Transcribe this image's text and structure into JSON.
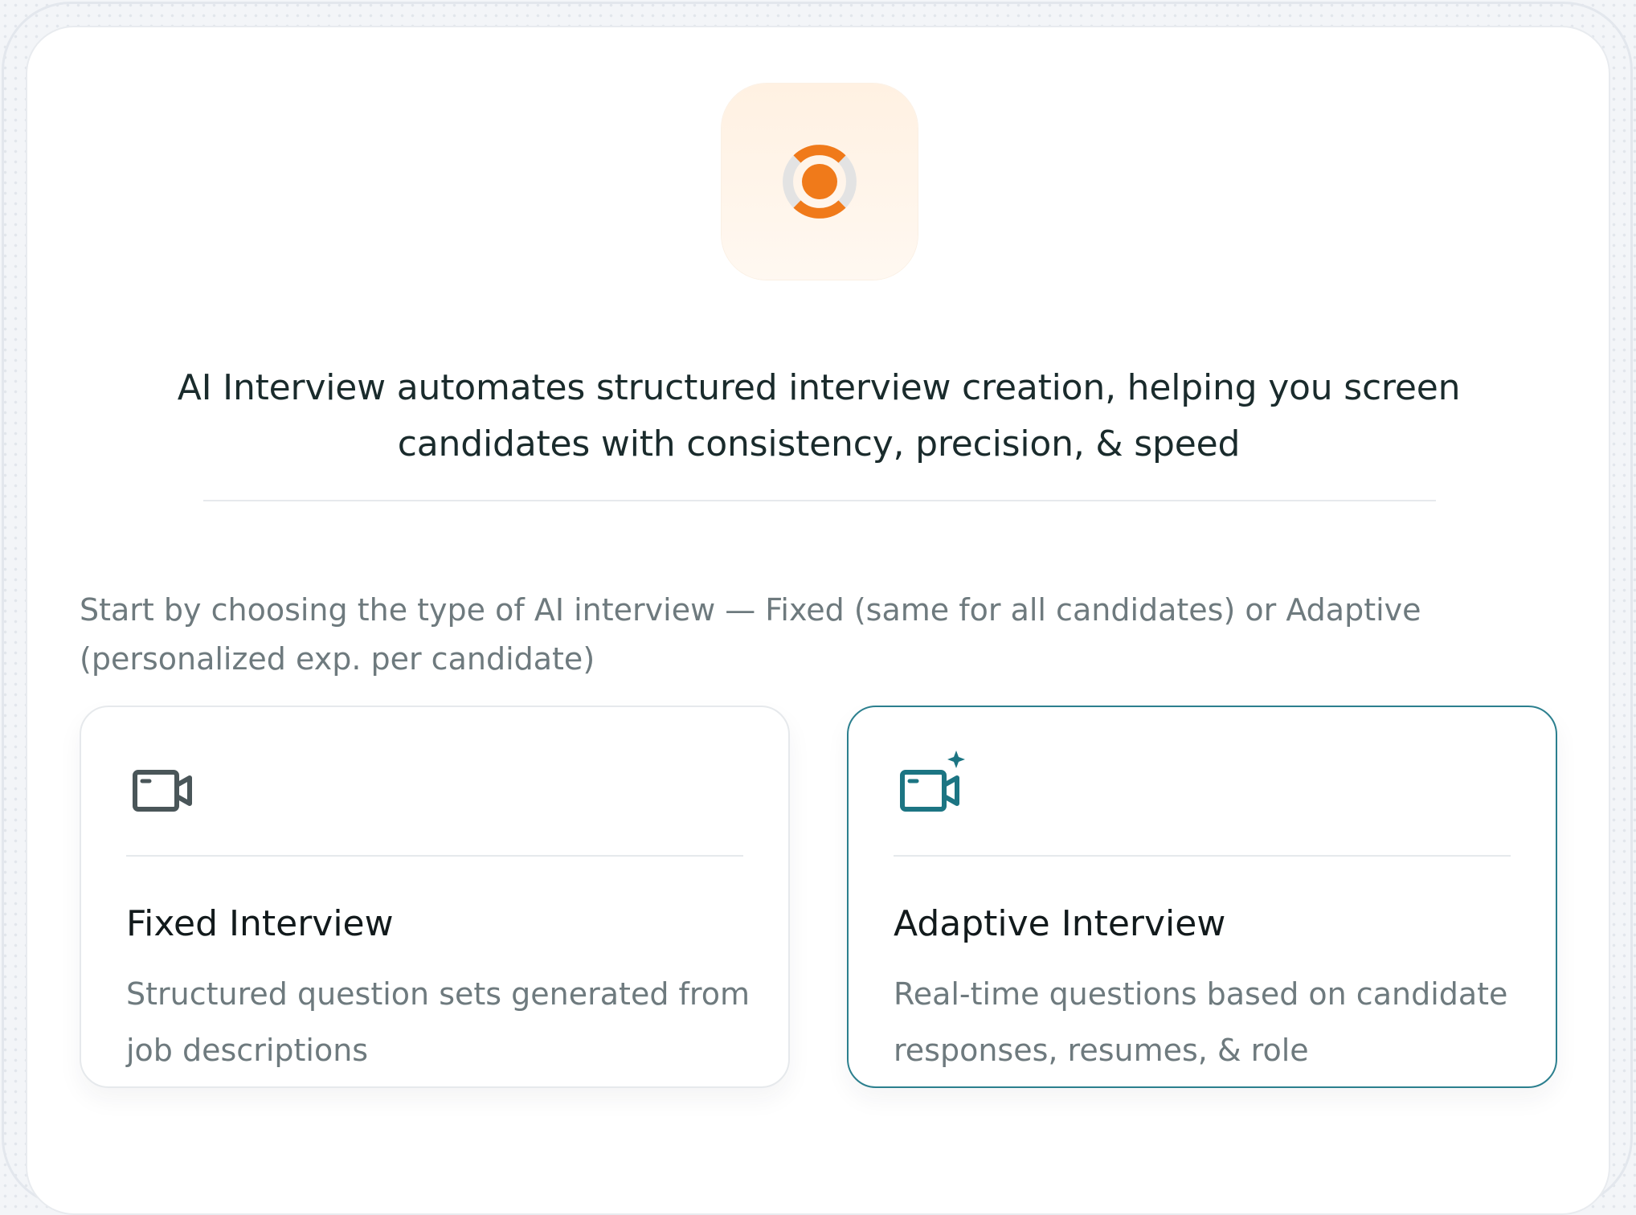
{
  "headline": "AI Interview automates structured interview creation, helping you screen candidates with consistency, precision, & speed",
  "intro": "Start by choosing the type of AI interview — Fixed (same for all candidates) or Adaptive (personalized exp. per candidate)",
  "logo": {
    "icon": "ai-interview-logo-icon",
    "accent_color": "#f07a1a"
  },
  "cards": [
    {
      "title": "Fixed Interview",
      "description": "Structured question sets generated from job descriptions",
      "icon": "video-camera-icon",
      "icon_color": "#4a5659",
      "selected": false
    },
    {
      "title": "Adaptive Interview",
      "description": "Real-time questions based on candidate responses, resumes, & role",
      "icon": "video-camera-sparkle-icon",
      "icon_color": "#1c7583",
      "selected": true
    }
  ]
}
